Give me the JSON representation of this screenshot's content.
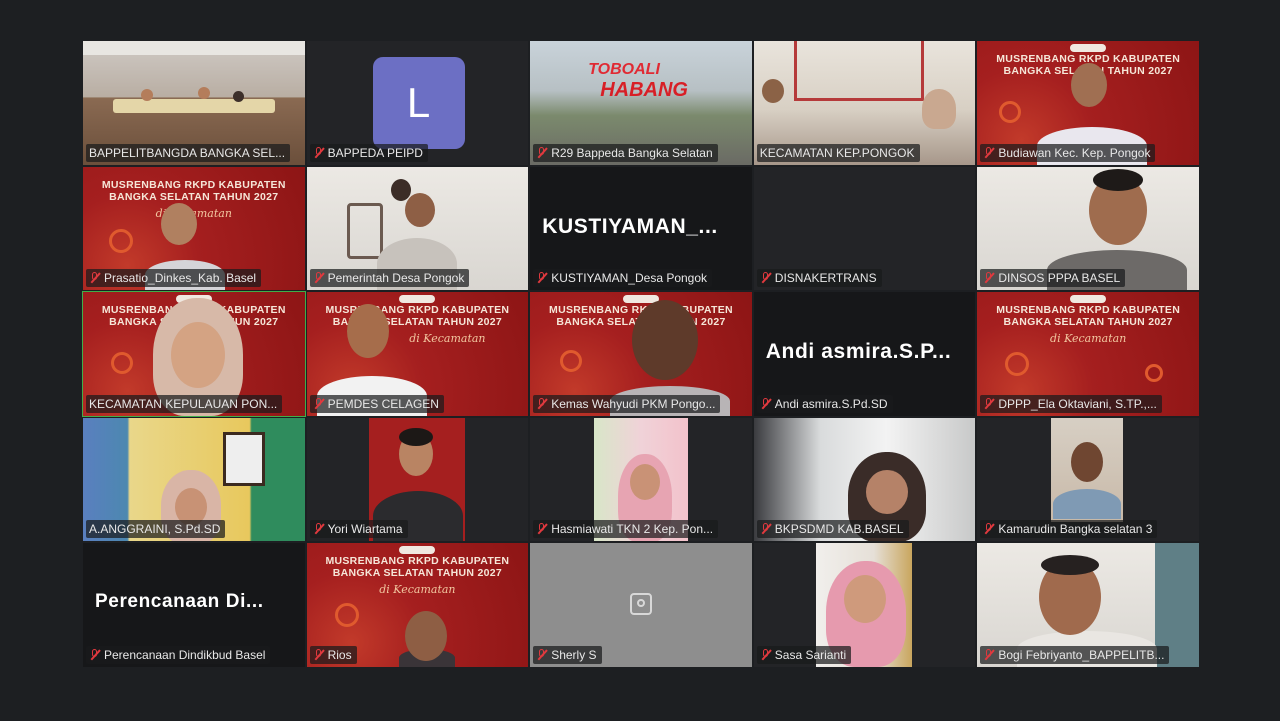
{
  "participants": [
    {
      "name": "BAPPELITBANGDA BANGKA SEL..."
    },
    {
      "name": "BAPPEDA PEIPD",
      "avatar_letter": "L"
    },
    {
      "name": "R29 Bappeda Bangka Selatan",
      "sign_text_1": "TOBOALI",
      "sign_text_2": "HABANG"
    },
    {
      "name": "KECAMATAN KEP.PONGOK"
    },
    {
      "name": "Budiawan Kec. Kep. Pongok"
    },
    {
      "name": "Prasatio_Dinkes_Kab. Basel"
    },
    {
      "name": "Pemerintah Desa Pongok"
    },
    {
      "name": "KUSTIYAMAN_Desa Pongok",
      "display_text": "KUSTIYAMAN_..."
    },
    {
      "name": "DISNAKERTRANS"
    },
    {
      "name": "DINSOS PPPA BASEL"
    },
    {
      "name": "KECAMATAN KEPULAUAN PON..."
    },
    {
      "name": "PEMDES CELAGEN"
    },
    {
      "name": "Kemas Wahyudi PKM Pongo..."
    },
    {
      "name": "Andi asmira.S.Pd.SD",
      "display_text": "Andi  asmira.S.P..."
    },
    {
      "name": "DPPP_Ela Oktaviani, S.TP.,..."
    },
    {
      "name": "A.ANGGRAINI, S.Pd.SD"
    },
    {
      "name": "Yori Wiartama"
    },
    {
      "name": "Hasmiawati TKN 2 Kep. Pon..."
    },
    {
      "name": "BKPSDMD KAB.BASEL"
    },
    {
      "name": "Kamarudin Bangka selatan 3"
    },
    {
      "name": "Perencanaan Dindikbud Basel",
      "display_text": "Perencanaan  Di..."
    },
    {
      "name": "Rios"
    },
    {
      "name": "Sherly S"
    },
    {
      "name": "Sasa Sarianti"
    },
    {
      "name": "Bogi Febriyanto_BAPPELITB..."
    }
  ],
  "banner": {
    "title_line1": "MUSRENBANG RKPD KABUPATEN",
    "title_line2": "BANGKA SELATAN TAHUN 2027",
    "script": "di Kecamatan"
  },
  "colors": {
    "banner_red": "#a51f1f",
    "active_speaker": "#3fae49",
    "muted_icon": "#e0393e",
    "avatar": "#6c6fc4"
  },
  "icons": {
    "muted": "mic-muted-icon",
    "camera_off": "camera-off-icon"
  }
}
